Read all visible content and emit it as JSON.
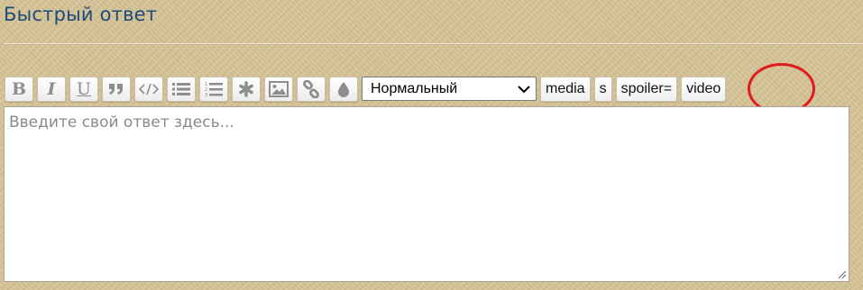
{
  "header": {
    "title": "Быстрый ответ"
  },
  "toolbar": {
    "buttons": [
      {
        "name": "bold-button",
        "label": "B"
      },
      {
        "name": "italic-button",
        "label": "I"
      },
      {
        "name": "underline-button",
        "label": "U"
      },
      {
        "name": "quote-button",
        "icon": "quote-icon"
      },
      {
        "name": "code-button",
        "icon": "code-icon"
      },
      {
        "name": "bullet-list-button",
        "icon": "bullet-list-icon"
      },
      {
        "name": "numbered-list-button",
        "icon": "numbered-list-icon"
      },
      {
        "name": "list-item-button",
        "icon": "asterisk-icon"
      },
      {
        "name": "image-button",
        "icon": "image-icon"
      },
      {
        "name": "link-button",
        "icon": "link-icon"
      },
      {
        "name": "color-button",
        "icon": "droplet-icon"
      }
    ],
    "font_size": {
      "selected": "Нормальный"
    },
    "tags": [
      "media",
      "s",
      "spoiler=",
      "video"
    ]
  },
  "editor": {
    "placeholder": "Введите свой ответ здесь..."
  },
  "colors": {
    "title": "#1f4b79",
    "highlight": "#e01b1b",
    "background": "#d6c396"
  }
}
